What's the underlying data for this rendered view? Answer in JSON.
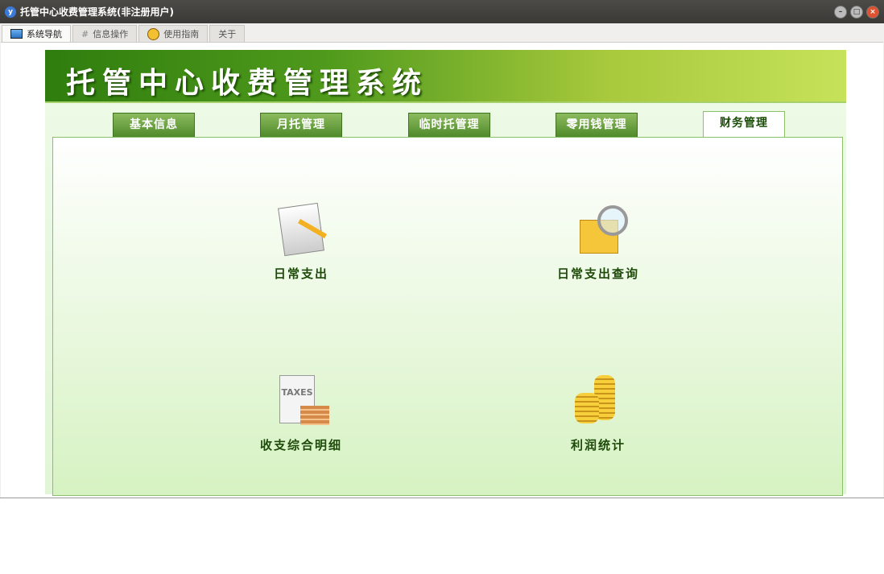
{
  "window": {
    "title": "托管中心收费管理系统(非注册用户)"
  },
  "tabs": [
    {
      "label": "系统导航"
    },
    {
      "label": "信息操作"
    },
    {
      "label": "使用指南"
    },
    {
      "label": "关于"
    }
  ],
  "banner": {
    "title": "托管中心收费管理系统"
  },
  "nav": [
    {
      "label": "基本信息"
    },
    {
      "label": "月托管理"
    },
    {
      "label": "临时托管理"
    },
    {
      "label": "零用钱管理"
    },
    {
      "label": "财务管理"
    }
  ],
  "items": [
    {
      "label": "日常支出"
    },
    {
      "label": "日常支出查询"
    },
    {
      "label": "收支综合明细",
      "icon_text": "TAXES"
    },
    {
      "label": "利润统计"
    }
  ]
}
